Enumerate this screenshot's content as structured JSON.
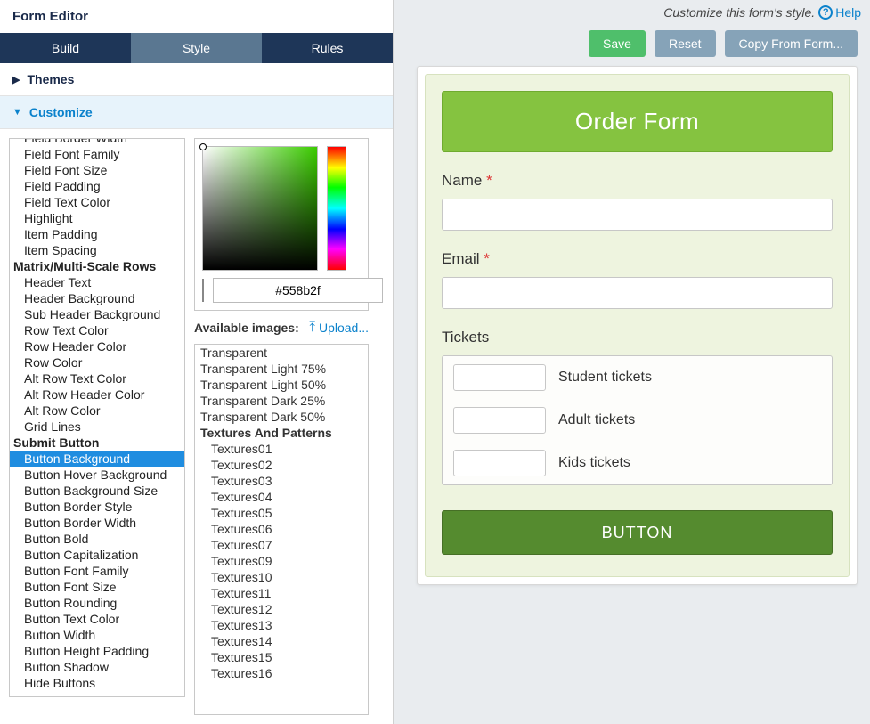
{
  "panel_title": "Form Editor",
  "tabs": {
    "build": "Build",
    "style": "Style",
    "rules": "Rules"
  },
  "sections": {
    "themes": "Themes",
    "customize": "Customize"
  },
  "props": {
    "items_above": [
      "Field Border Width",
      "Field Font Family",
      "Field Font Size",
      "Field Padding",
      "Field Text Color",
      "Highlight",
      "Item Padding",
      "Item Spacing"
    ],
    "group_matrix": "Matrix/Multi-Scale Rows",
    "matrix_items": [
      "Header Text",
      "Header Background",
      "Sub Header Background",
      "Row Text Color",
      "Row Header Color",
      "Row Color",
      "Alt Row Text Color",
      "Alt Row Header Color",
      "Alt Row Color",
      "Grid Lines"
    ],
    "group_submit": "Submit Button",
    "submit_items": [
      "Button Background",
      "Button Hover Background",
      "Button Background Size",
      "Button Border Style",
      "Button Border Width",
      "Button Bold",
      "Button Capitalization",
      "Button Font Family",
      "Button Font Size",
      "Button Rounding",
      "Button Text Color",
      "Button Width",
      "Button Height Padding",
      "Button Shadow",
      "Hide Buttons"
    ],
    "selected": "Button Background"
  },
  "color": {
    "hex": "#558b2f",
    "swatch": "#558b2f"
  },
  "images_header": "Available images:",
  "upload_label": "Upload...",
  "images": {
    "roots": [
      "Transparent",
      "Transparent Light 75%",
      "Transparent Light 50%",
      "Transparent Dark 25%",
      "Transparent Dark 50%"
    ],
    "group": "Textures And Patterns",
    "textures": [
      "Textures01",
      "Textures02",
      "Textures03",
      "Textures04",
      "Textures05",
      "Textures06",
      "Textures07",
      "Textures09",
      "Textures10",
      "Textures11",
      "Textures12",
      "Textures13",
      "Textures14",
      "Textures15",
      "Textures16"
    ]
  },
  "topbar": {
    "hint": "Customize this form's style.",
    "help": "Help"
  },
  "actions": {
    "save": "Save",
    "reset": "Reset",
    "copy": "Copy From Form..."
  },
  "form": {
    "title": "Order Form",
    "name_label": "Name",
    "email_label": "Email",
    "tickets_label": "Tickets",
    "tickets": [
      "Student tickets",
      "Adult tickets",
      "Kids tickets"
    ],
    "submit_label": "BUTTON"
  }
}
